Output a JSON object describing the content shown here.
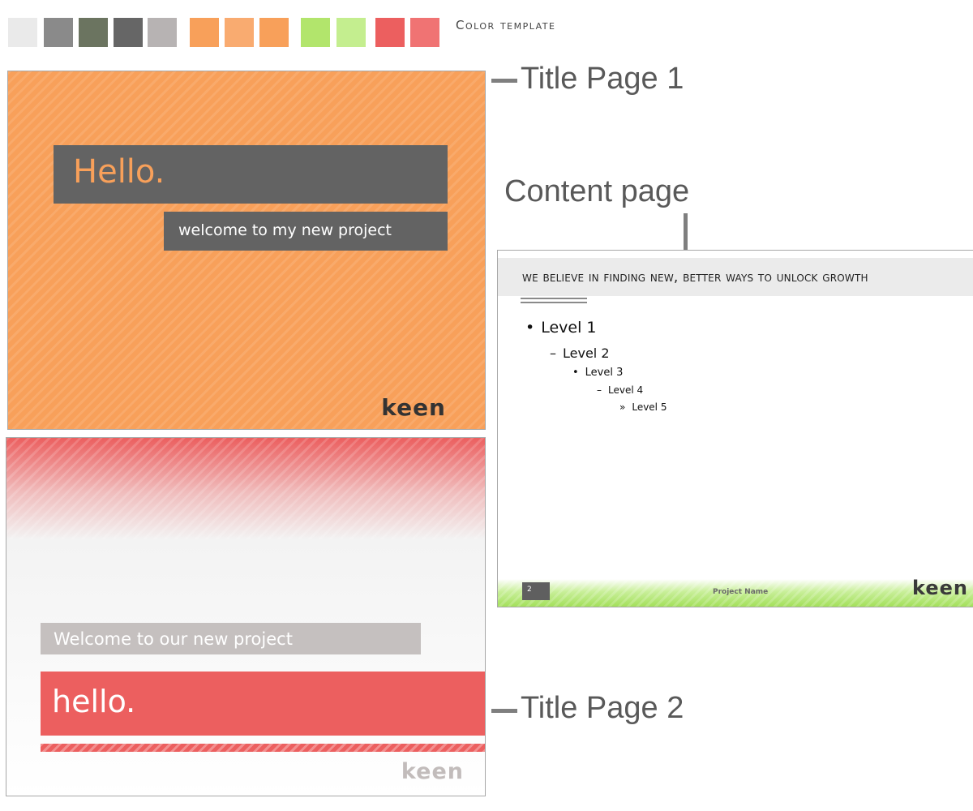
{
  "palette": {
    "label": "Color template",
    "swatches": [
      "#eaeaea",
      "#8a8a8a",
      "#6b7460",
      "#666666",
      "#b7b3b3",
      "#f8a05a",
      "#f9ab70",
      "#f8a05a",
      "#b2e56c",
      "#c4ee8f",
      "#ec5f5f",
      "#f07373"
    ]
  },
  "captions": {
    "title_page_1": "Title Page 1",
    "content_page": "Content page",
    "title_page_2": "Title Page 2"
  },
  "slide1": {
    "heading": "Hello.",
    "subheading": "welcome to my new project",
    "logo": "keen",
    "colors": {
      "background": "#f8a05a",
      "box": "#636363",
      "heading": "#f8a05a"
    }
  },
  "content_slide": {
    "header": "We believe in finding new, better ways to unlock growth",
    "levels": [
      "Level 1",
      "Level 2",
      "Level 3",
      "Level 4",
      "Level 5"
    ],
    "bullets": [
      "•",
      "–",
      "•",
      "–",
      "»"
    ],
    "page_number": "2",
    "footer_text": "Project Name",
    "logo": "keen",
    "colors": {
      "header_bar": "#ebebeb",
      "footer": "#a3e05a"
    }
  },
  "slide2": {
    "subtitle": "Welcome to our new project",
    "heading": "hello.",
    "logo": "keen",
    "colors": {
      "accent": "#ec5f5f",
      "subtitle_box": "#c5c0bf"
    }
  }
}
